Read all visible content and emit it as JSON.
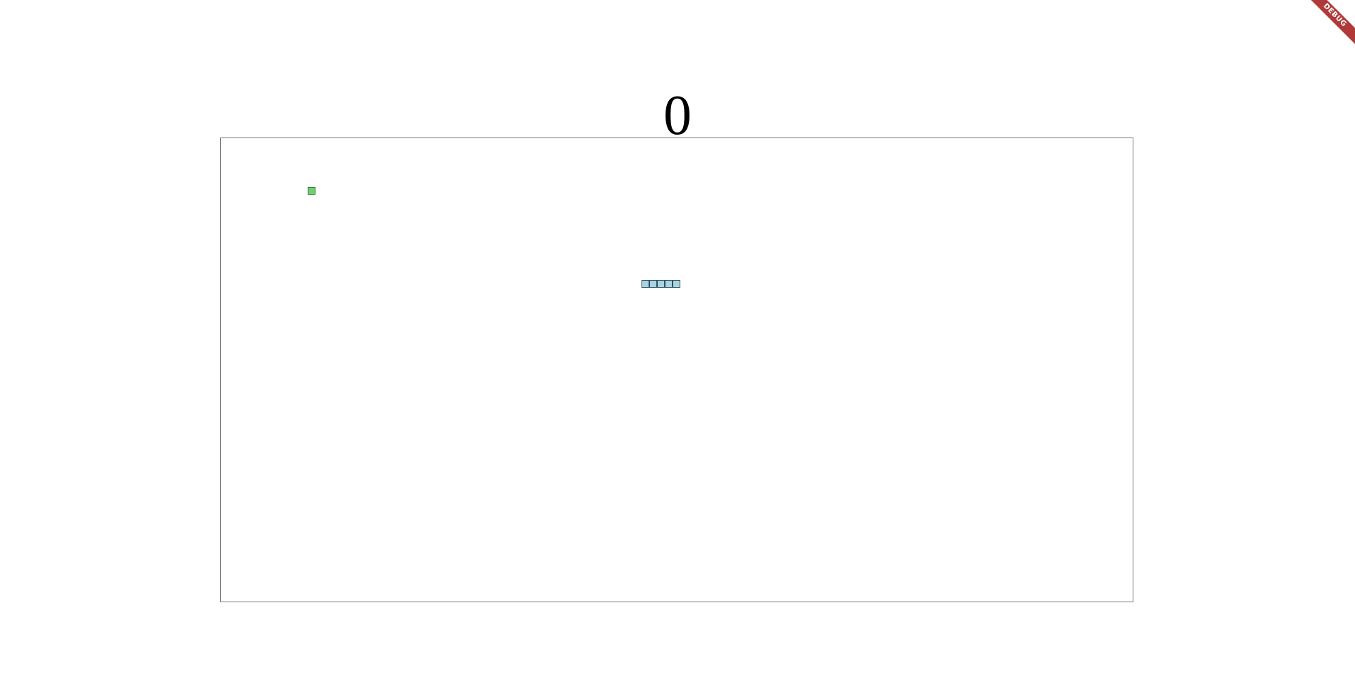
{
  "score": "0",
  "game": {
    "grid_columns": 120,
    "grid_rows": 61,
    "food": {
      "col": 5,
      "row": 3
    },
    "snake": [
      {
        "col": 48,
        "row": 15
      },
      {
        "col": 49,
        "row": 15
      },
      {
        "col": 50,
        "row": 15
      },
      {
        "col": 51,
        "row": 15
      },
      {
        "col": 52,
        "row": 15
      }
    ]
  },
  "debug_banner": "DEBUG",
  "colors": {
    "score": "#000000",
    "board_border": "#777777",
    "snake": "#a8d3e0",
    "food": "#6fd06f",
    "banner": "#b03a3a"
  }
}
